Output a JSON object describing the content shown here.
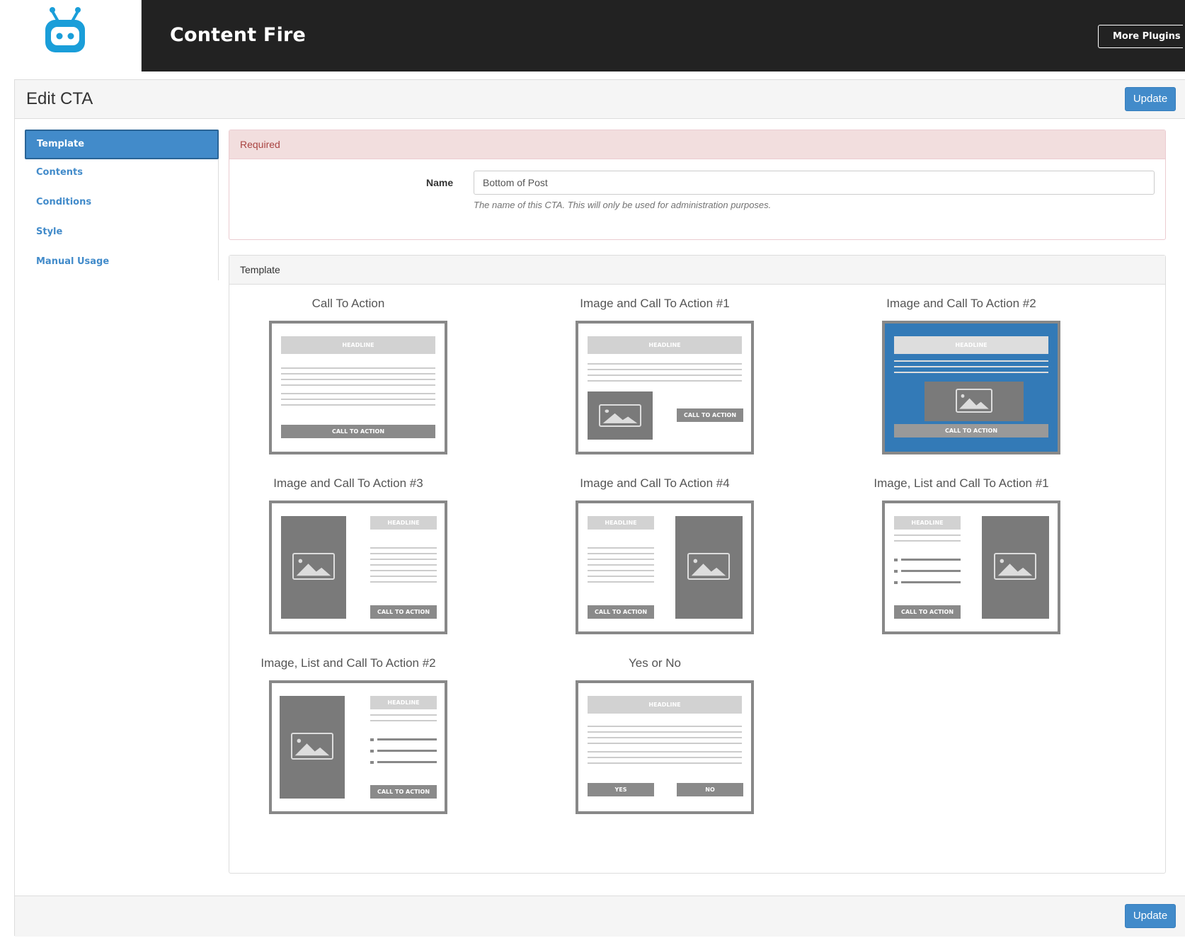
{
  "header": {
    "app_title": "Content Fire",
    "more_plugins_label": "More Plugins"
  },
  "page": {
    "title": "Edit CTA",
    "update_label": "Update"
  },
  "sidebar": {
    "items": [
      {
        "label": "Template",
        "active": true
      },
      {
        "label": "Contents",
        "active": false
      },
      {
        "label": "Conditions",
        "active": false
      },
      {
        "label": "Style",
        "active": false
      },
      {
        "label": "Manual Usage",
        "active": false
      }
    ]
  },
  "required": {
    "heading": "Required",
    "name_label": "Name",
    "name_value": "Bottom of Post",
    "name_help": "The name of this CTA. This will only be used for administration purposes."
  },
  "templates": {
    "heading": "Template",
    "headline_text": "HEADLINE",
    "cta_text": "CALL TO ACTION",
    "yes_text": "YES",
    "no_text": "NO",
    "items": [
      {
        "title": "Call To Action",
        "selected": false
      },
      {
        "title": "Image and Call To Action #1",
        "selected": false
      },
      {
        "title": "Image and Call To Action #2",
        "selected": true
      },
      {
        "title": "Image and Call To Action #3",
        "selected": false
      },
      {
        "title": "Image and Call To Action #4",
        "selected": false
      },
      {
        "title": "Image, List and Call To Action #1",
        "selected": false
      },
      {
        "title": "Image, List and Call To Action #2",
        "selected": false
      },
      {
        "title": "Yes or No",
        "selected": false
      }
    ]
  },
  "colors": {
    "primary": "#428bca",
    "header_bg": "#222222",
    "logo": "#1a9ed9",
    "selected_template_bg": "#337ab7"
  }
}
